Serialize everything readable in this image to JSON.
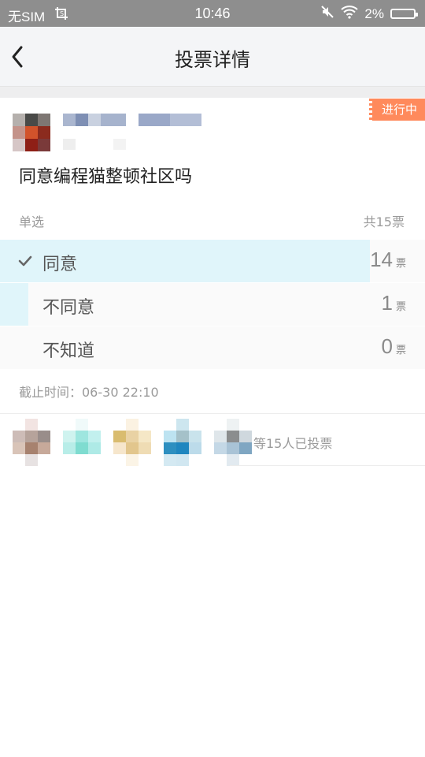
{
  "status_bar": {
    "carrier": "无SIM",
    "time": "10:46",
    "battery_pct": "2%"
  },
  "nav": {
    "title": "投票详情"
  },
  "poll": {
    "status_badge": "进行中",
    "question": "同意编程猫整顿社区吗",
    "type_label": "单选",
    "total_label": "共15票",
    "total_votes": 15,
    "options": [
      {
        "label": "同意",
        "count": "14",
        "unit": "票",
        "selected": true,
        "fraction": 0.933
      },
      {
        "label": "不同意",
        "count": "1",
        "unit": "票",
        "selected": false,
        "fraction": 0.067
      },
      {
        "label": "不知道",
        "count": "0",
        "unit": "票",
        "selected": false,
        "fraction": 0.0
      }
    ],
    "deadline": "截止时间：06-30 22:10",
    "voters_label": "等15人已投票"
  },
  "colors": {
    "accent_badge": "#ff8a5c",
    "bar_fill": "#e0f5fa",
    "status_bar": "#8e8e8e"
  }
}
